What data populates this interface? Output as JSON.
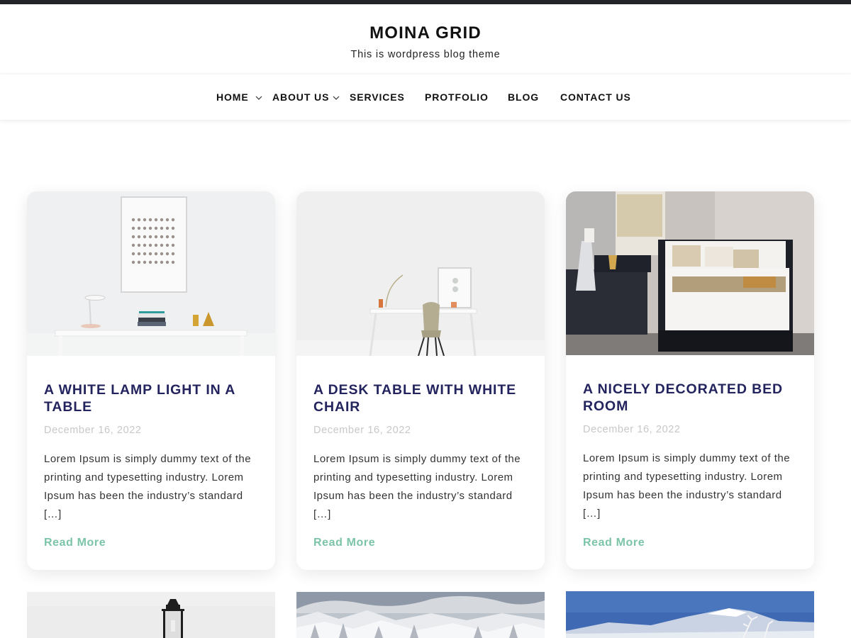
{
  "site": {
    "title": "MOINA GRID",
    "description": "This is wordpress blog theme"
  },
  "nav": {
    "items": [
      {
        "label": "HOME",
        "has_submenu": true
      },
      {
        "label": "ABOUT US",
        "has_submenu": true
      },
      {
        "label": "SERVICES",
        "has_submenu": false
      },
      {
        "label": "PROTFOLIO",
        "has_submenu": false
      },
      {
        "label": "BLOG",
        "has_submenu": false
      },
      {
        "label": "CONTACT US",
        "has_submenu": false
      }
    ],
    "caret_icon": "chevron-down-icon"
  },
  "posts": [
    {
      "title": "A WHITE LAMP LIGHT IN A TABLE",
      "date": "December 16, 2022",
      "excerpt": "Lorem Ipsum is simply dummy text of the printing and typesetting industry. Lorem Ipsum has been the industry’s standard […]",
      "read_more": "Read More",
      "image": "white-desk-lamp-photo"
    },
    {
      "title": "A DESK TABLE WITH WHITE CHAIR",
      "date": "December 16, 2022",
      "excerpt": "Lorem Ipsum is simply dummy text of the printing and typesetting industry. Lorem Ipsum has been the industry’s standard […]",
      "read_more": "Read More",
      "image": "desk-chair-photo"
    },
    {
      "title": "A NICELY DECORATED BED ROOM",
      "date": "December 16, 2022",
      "excerpt": "Lorem Ipsum is simply dummy text of the printing and typesetting industry. Lorem Ipsum has been the industry’s standard […]",
      "read_more": "Read More",
      "image": "bedroom-photo"
    }
  ],
  "posts_row2": [
    {
      "image": "lantern-photo"
    },
    {
      "image": "snowy-forest-photo"
    },
    {
      "image": "snowy-mountain-photo"
    }
  ],
  "colors": {
    "title": "#23235e",
    "read_more": "#7cc4a8",
    "date": "#c8c8c8",
    "topbar": "#222326"
  }
}
